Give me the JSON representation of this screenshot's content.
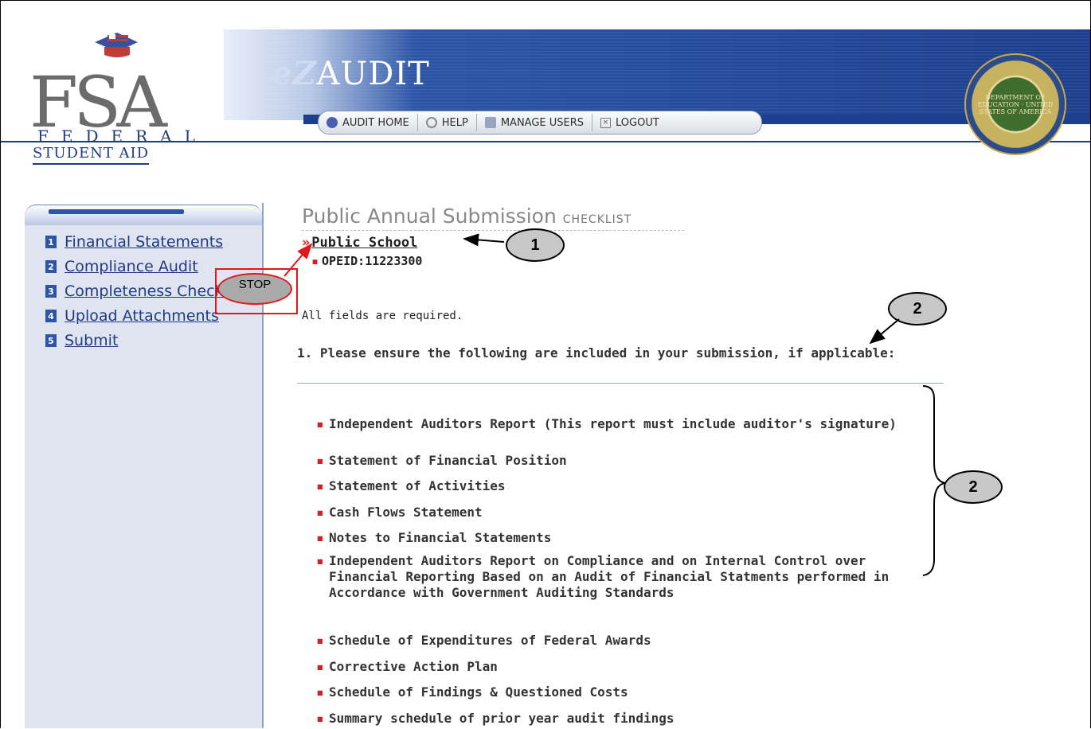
{
  "brand": {
    "logo_letters": "FSA",
    "logo_line1": "FEDERAL",
    "logo_line2": "STUDENT AID",
    "app_title_prefix": "eZ",
    "app_title": "AUDIT",
    "seal_text": "DEPARTMENT OF EDUCATION · UNITED STATES OF AMERICA"
  },
  "nav": {
    "items": [
      {
        "label": "AUDIT HOME",
        "icon": "ez-audit-icon"
      },
      {
        "label": "HELP",
        "icon": "help-icon"
      },
      {
        "label": "MANAGE USERS",
        "icon": "users-icon"
      },
      {
        "label": "LOGOUT",
        "icon": "close-box-icon"
      }
    ]
  },
  "sidebar": {
    "items": [
      {
        "num": "1",
        "label": "Financial Statements"
      },
      {
        "num": "2",
        "label": "Compliance Audit"
      },
      {
        "num": "3",
        "label": "Completeness Checkl"
      },
      {
        "num": "4",
        "label": "Upload Attachments"
      },
      {
        "num": "5",
        "label": "Submit"
      }
    ]
  },
  "main": {
    "title": "Public Annual Submission",
    "title_sub": "CHECKLIST",
    "school_chevron": "»",
    "school_name": "Public School",
    "opeid_bullet": "▪",
    "opeid": "OPEID:11223300",
    "required_note": "All fields are required.",
    "question": "1. Please ensure the following are included in your submission, if applicable:",
    "bullet": "▪",
    "checklist": [
      "Independent Auditors Report (This report must include auditor's signature)",
      "Statement of Financial Position",
      "Statement of Activities",
      "Cash Flows Statement",
      "Notes to Financial Statements",
      "Independent Auditors Report on Compliance and on Internal Control over Financial Reporting Based on an Audit of Financial Statments performed in Accordance with Government Auditing Standards",
      "Schedule of Expenditures of Federal Awards",
      "Corrective Action Plan",
      "Schedule of Findings & Questioned Costs",
      "Summary schedule of prior year audit findings"
    ]
  },
  "annotations": {
    "callout_1": "1",
    "callout_2a": "2",
    "callout_2b": "2",
    "stop_label": "STOP"
  },
  "colors": {
    "brand_blue": "#1f3b86",
    "accent_red": "#d62020",
    "sidebar_bg": "#dfe4f0"
  }
}
